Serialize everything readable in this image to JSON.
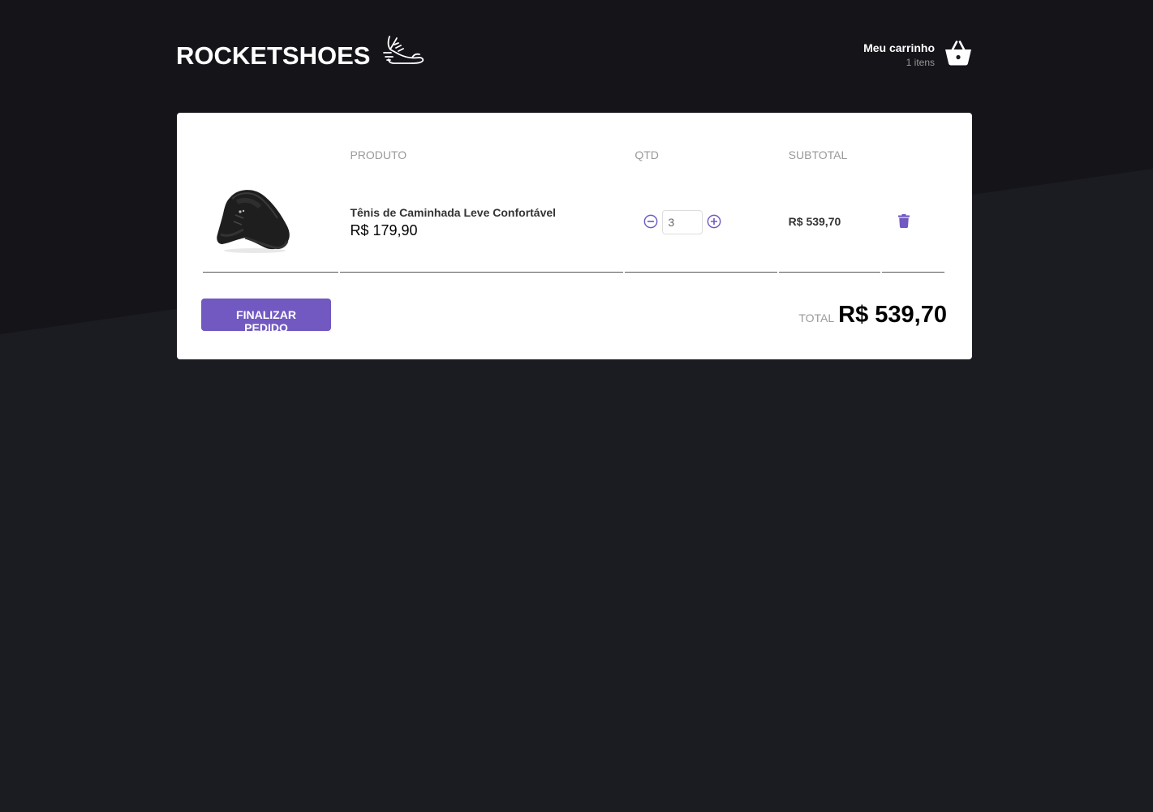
{
  "brand": {
    "name": "ROCKETSHOES",
    "logo_icon": "running-shoe-icon"
  },
  "cart_summary": {
    "title": "Meu carrinho",
    "count": "1 itens",
    "icon": "shopping-basket-icon"
  },
  "table": {
    "headers": {
      "image": "",
      "product": "PRODUTO",
      "qtd": "QTD",
      "subtotal": "SUBTOTAL",
      "actions": ""
    },
    "items": [
      {
        "title": "Tênis de Caminhada Leve Confortável",
        "price": "R$ 179,90",
        "amount": "3",
        "subtotal": "R$ 539,70",
        "image_icon": "black-sneaker-image"
      }
    ]
  },
  "footer": {
    "button_label": "FINALIZAR PEDIDO",
    "total_label": "TOTAL",
    "total_value": "R$ 539,70"
  },
  "colors": {
    "background": "#1b1c21",
    "accent": "#7159c1",
    "panel": "#ffffff"
  }
}
